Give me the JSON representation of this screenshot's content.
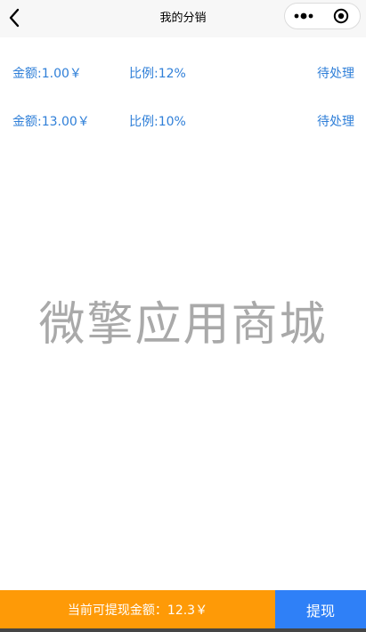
{
  "header": {
    "title": "我的分销",
    "back_icon": "chevron-left-icon",
    "menu_icon": "more-dots-icon",
    "close_icon": "target-close-icon"
  },
  "records": [
    {
      "amount": "金额:1.00￥",
      "ratio": "比例:12%",
      "status": "待处理"
    },
    {
      "amount": "金额:13.00￥",
      "ratio": "比例:10%",
      "status": "待处理"
    }
  ],
  "watermark": "微擎应用商城",
  "footer": {
    "withdrawable_text": "当前可提现金额：12.3￥",
    "withdraw_label": "提现"
  },
  "colors": {
    "link_blue": "#2f7fd8",
    "orange": "#fe9a07",
    "button_blue": "#2f80f7",
    "watermark_gray": "#a9a9a9"
  }
}
